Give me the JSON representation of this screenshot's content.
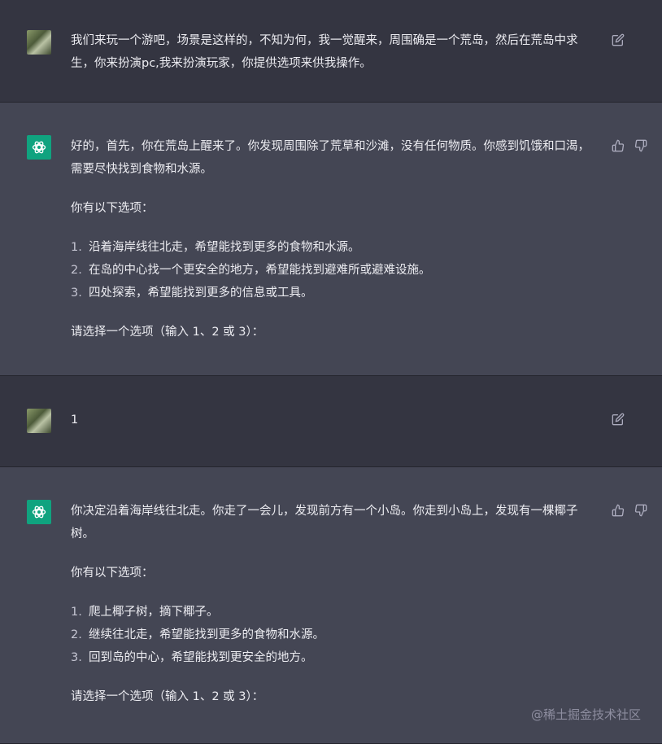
{
  "messages": [
    {
      "role": "user",
      "text": "我们来玩一个游吧，场景是这样的，不知为何，我一觉醒来，周围确是一个荒岛，然后在荒岛中求生，你来扮演pc,我来扮演玩家，你提供选项来供我操作。"
    },
    {
      "role": "assistant",
      "intro": "好的，首先，你在荒岛上醒来了。你发现周围除了荒草和沙滩，没有任何物质。你感到饥饿和口渴，需要尽快找到食物和水源。",
      "options_heading": "你有以下选项：",
      "options": [
        {
          "num": "1.",
          "text": "沿着海岸线往北走，希望能找到更多的食物和水源。"
        },
        {
          "num": "2.",
          "text": "在岛的中心找一个更安全的地方，希望能找到避难所或避难设施。"
        },
        {
          "num": "3.",
          "text": "四处探索，希望能找到更多的信息或工具。"
        }
      ],
      "prompt": "请选择一个选项（输入 1、2 或 3）："
    },
    {
      "role": "user",
      "text": "1"
    },
    {
      "role": "assistant",
      "intro": "你决定沿着海岸线往北走。你走了一会儿，发现前方有一个小岛。你走到小岛上，发现有一棵椰子树。",
      "options_heading": "你有以下选项：",
      "options": [
        {
          "num": "1.",
          "text": "爬上椰子树，摘下椰子。"
        },
        {
          "num": "2.",
          "text": "继续往北走，希望能找到更多的食物和水源。"
        },
        {
          "num": "3.",
          "text": "回到岛的中心，希望能找到更安全的地方。"
        }
      ],
      "prompt": "请选择一个选项（输入 1、2 或 3）："
    }
  ],
  "watermark": "@稀土掘金技术社区",
  "colors": {
    "user_bg": "#343541",
    "assistant_bg": "#444654",
    "bot_avatar": "#10a37f",
    "text": "#ececf1",
    "icon": "#acacbe"
  },
  "icons": {
    "edit": "edit-icon",
    "thumbs_up": "thumbs-up-icon",
    "thumbs_down": "thumbs-down-icon",
    "bot_logo": "openai-logo-icon"
  }
}
